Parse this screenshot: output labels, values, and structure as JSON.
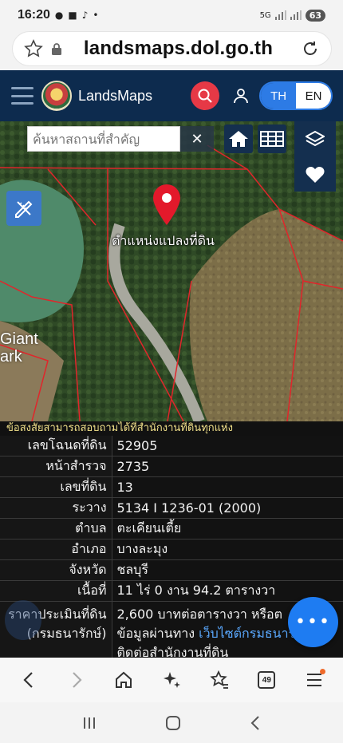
{
  "status_bar": {
    "time": "16:20",
    "network": "5G",
    "battery": "63"
  },
  "url_bar": {
    "url": "landsmaps.dol.go.th"
  },
  "header": {
    "brand": "LandsMaps",
    "lang_th": "TH",
    "lang_en": "EN",
    "accent_color": "#e63946",
    "bg_color": "#0d2b4e"
  },
  "map": {
    "search_placeholder": "ค้นหาสถานที่สำคัญ",
    "clear_label": "✕",
    "parcel_label": "ตำแหน่งแปลงที่ดิน",
    "park_label_line1": "Giant",
    "park_label_line2": "ark"
  },
  "info": {
    "notice": "ข้อสงสัยสามารถสอบถามได้ที่สำนักงานที่ดินทุกแห่ง",
    "rows": [
      {
        "label": "เลขโฉนดที่ดิน",
        "value": "52905"
      },
      {
        "label": "หน้าสำรวจ",
        "value": "2735"
      },
      {
        "label": "เลขที่ดิน",
        "value": "13"
      },
      {
        "label": "ระวาง",
        "value": "5134 I 1236-01 (2000)"
      },
      {
        "label": "ตำบล",
        "value": "ตะเคียนเตี้ย"
      },
      {
        "label": "อำเภอ",
        "value": "บางละมุง"
      },
      {
        "label": "จังหวัด",
        "value": "ชลบุรี"
      },
      {
        "label": "เนื้อที่",
        "value": "11 ไร่ 0 งาน 94.2 ตารางวา"
      }
    ],
    "price": {
      "label_line1": "ราคาประเมินที่ดิน",
      "label_line2": "(กรมธนารักษ์)",
      "line1": "2,600 บาทต่อตารางวา หรือต",
      "line2_prefix": "ข้อมูลผ่านทาง ",
      "line2_link": "เว็บไซต์กรมธนาร",
      "line2_suffix": "อ",
      "line3": "ติดต่อสำนักงานที่ดิน"
    },
    "fab_label": "•••"
  },
  "browser_bar": {
    "tab_count": "49"
  }
}
